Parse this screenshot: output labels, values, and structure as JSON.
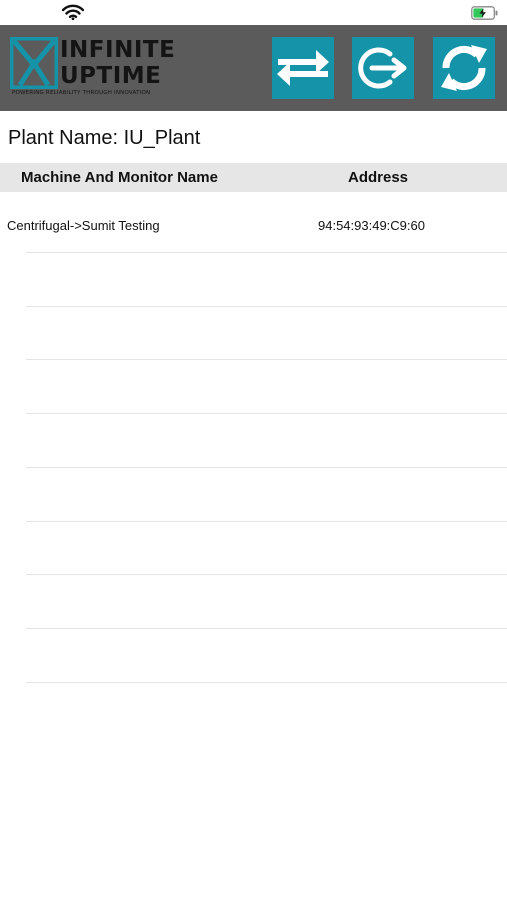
{
  "brand": {
    "line1": "INFINITE",
    "line2": "UPTIME",
    "tagline": "POWERING RELIABILITY THROUGH INNOVATION",
    "accent_color": "#1593a9",
    "header_color": "#5b5b5b"
  },
  "icons": {
    "wifi": "wifi-icon",
    "battery": "battery-charging-icon",
    "swap": "swap-arrows-icon",
    "logout": "logout-icon",
    "refresh": "refresh-icon"
  },
  "plant": {
    "label": "Plant Name: IU_Plant"
  },
  "table": {
    "columns": [
      "Machine And Monitor Name",
      "Address"
    ],
    "rows": [
      {
        "name": "Centrifugal->Sumit Testing",
        "address": "94:54:93:49:C9:60"
      }
    ]
  }
}
